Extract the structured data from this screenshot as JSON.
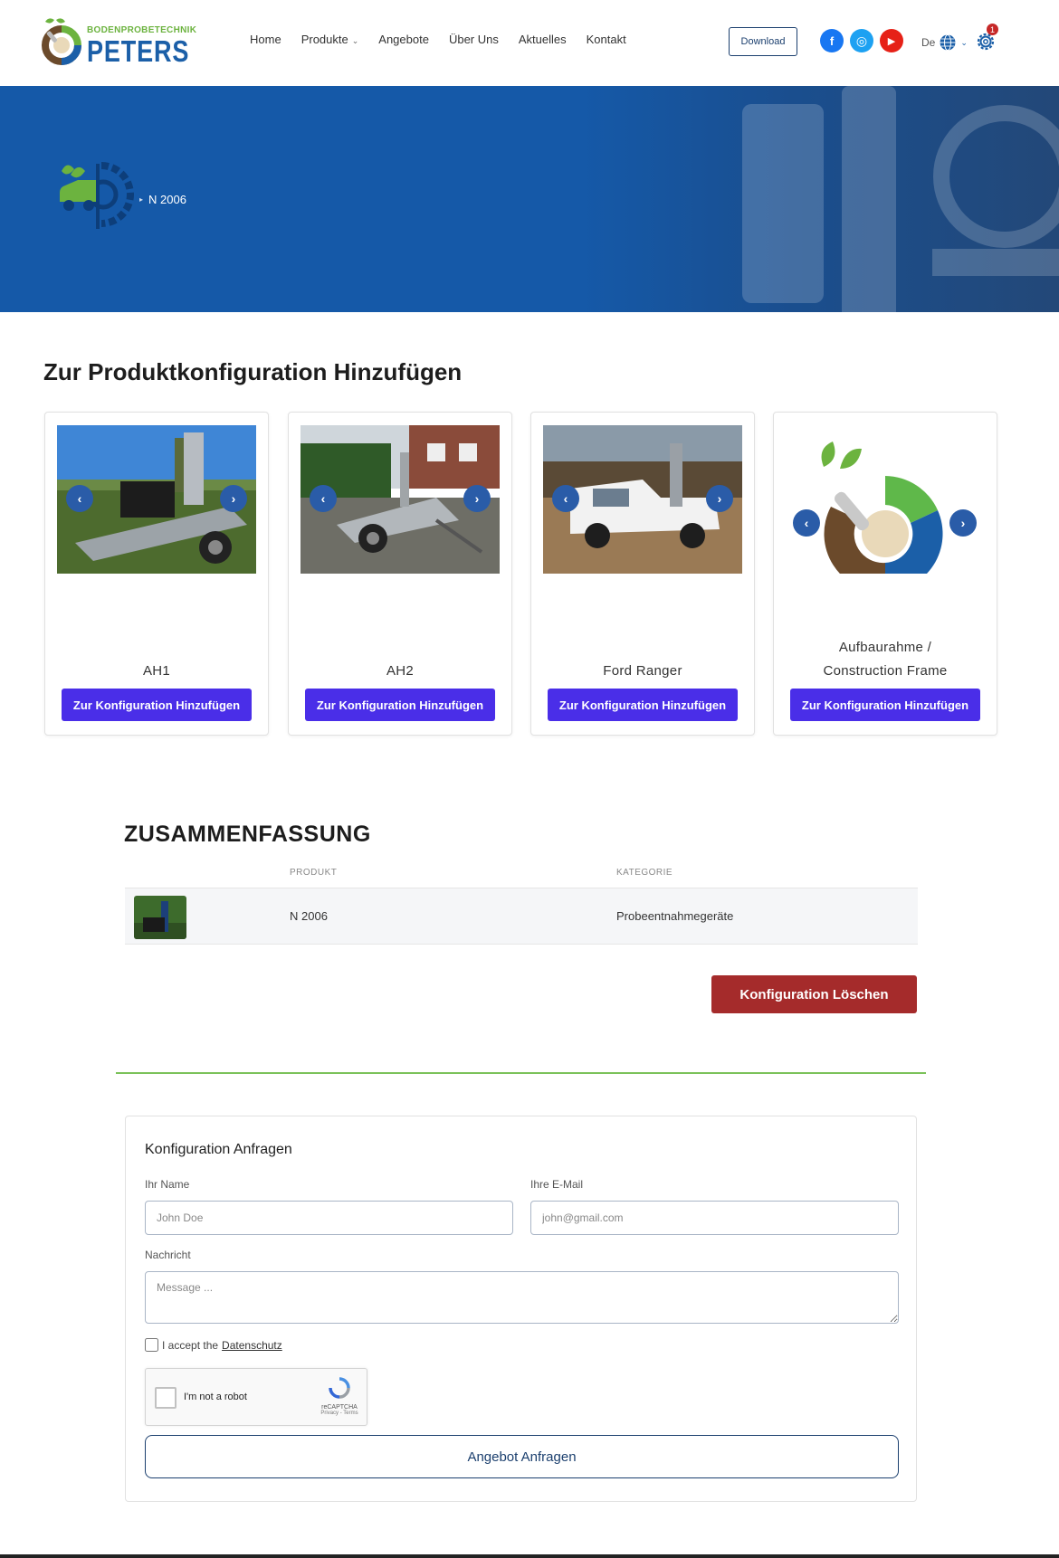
{
  "header": {
    "logo_sub": "BODENPROBETECHNIK",
    "logo_main": "PETERS",
    "nav": [
      {
        "label": "Home"
      },
      {
        "label": "Produkte"
      },
      {
        "label": "Angebote"
      },
      {
        "label": "Über Uns"
      },
      {
        "label": "Aktuelles"
      },
      {
        "label": "Kontakt"
      }
    ],
    "download_label": "Download",
    "social": [
      {
        "name": "facebook-icon",
        "glyph": "f",
        "color": "#1877f2"
      },
      {
        "name": "instagram-icon",
        "glyph": "◎",
        "color": "#1da1f2"
      },
      {
        "name": "youtube-icon",
        "glyph": "▶",
        "color": "#e62117"
      }
    ],
    "language": "De",
    "config_count": "1"
  },
  "hero": {
    "breadcrumb": "N 2006"
  },
  "section_title": "Zur Produktkonfiguration Hinzufügen",
  "products": [
    {
      "name": "AH1",
      "button": "Zur Konfiguration Hinzufügen",
      "image": "trailer-photo"
    },
    {
      "name": "AH2",
      "button": "Zur Konfiguration Hinzufügen",
      "image": "trailer-photo"
    },
    {
      "name": "Ford Ranger",
      "button": "Zur Konfiguration Hinzufügen",
      "image": "pickup-photo"
    },
    {
      "name_line1": "Aufbaurahme /",
      "name_line2": "Construction Frame",
      "button": "Zur Konfiguration Hinzufügen",
      "image": "logo-graphic"
    }
  ],
  "summary": {
    "title": "ZUSAMMENFASSUNG",
    "col_product": "PRODUKT",
    "col_category": "KATEGORIE",
    "row": {
      "product": "N 2006",
      "category": "Probeentnahmegeräte"
    },
    "delete_button": "Konfiguration Löschen"
  },
  "form": {
    "title": "Konfiguration Anfragen",
    "name_label": "Ihr Name",
    "name_placeholder": "John Doe",
    "email_label": "Ihre E-Mail",
    "email_placeholder": "john@gmail.com",
    "message_label": "Nachricht",
    "message_placeholder": "Message ...",
    "accept_text": "I accept the",
    "accept_link": "Datenschutz",
    "captcha_text": "I'm not a robot",
    "captcha_brand": "reCAPTCHA",
    "captcha_links": "Privacy - Terms",
    "submit_label": "Angebot Anfragen"
  },
  "colors": {
    "brand_blue": "#1b5fa8",
    "brand_green": "#6cb33f",
    "hero_blue": "#1559a8",
    "button_purple": "#4a2ee8",
    "delete_red": "#a52b2b",
    "divider_green": "#7bc25a"
  }
}
